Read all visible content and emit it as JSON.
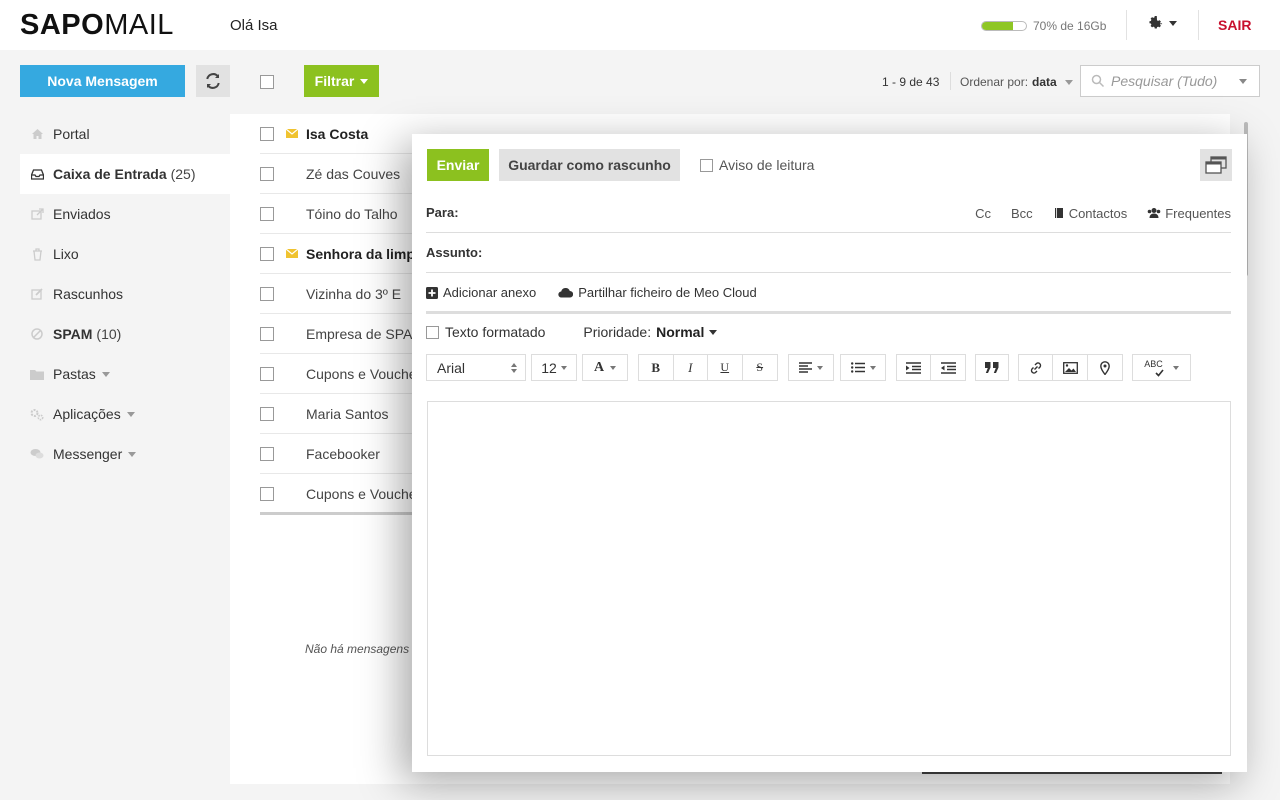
{
  "header": {
    "logo_bold": "SAPO",
    "logo_light": "MAIL",
    "greeting": "Olá Isa",
    "quota_text": "70% de 16Gb",
    "quota_percent": 70,
    "logout": "SAIR",
    "settings_icon": "gear-icon"
  },
  "toolbar": {
    "new_message": "Nova Mensagem",
    "refresh_icon": "refresh-icon",
    "filter": "Filtrar",
    "paging": "1 - 9 de 43",
    "order_label": "Ordenar por:",
    "order_value": "data",
    "search_placeholder": "Pesquisar (Tudo)"
  },
  "sidebar": {
    "items": [
      {
        "label": "Portal",
        "icon": "home-icon",
        "count": ""
      },
      {
        "label": "Caixa de Entrada",
        "icon": "inbox-icon",
        "count": "(25)"
      },
      {
        "label": "Enviados",
        "icon": "sent-icon",
        "count": ""
      },
      {
        "label": "Lixo",
        "icon": "trash-icon",
        "count": ""
      },
      {
        "label": "Rascunhos",
        "icon": "drafts-icon",
        "count": ""
      },
      {
        "label": "SPAM",
        "icon": "spam-icon",
        "count": "(10)"
      },
      {
        "label": "Pastas",
        "icon": "folder-icon",
        "count": ""
      },
      {
        "label": "Aplicações",
        "icon": "apps-icon",
        "count": ""
      },
      {
        "label": "Messenger",
        "icon": "chat-icon",
        "count": ""
      }
    ]
  },
  "messages": [
    {
      "from": "Isa Costa",
      "unread": true
    },
    {
      "from": "Zé das Couves",
      "unread": false
    },
    {
      "from": "Tóino do Talho",
      "unread": false
    },
    {
      "from": "Senhora da limpe",
      "unread": true
    },
    {
      "from": "Vizinha do 3º E",
      "unread": false
    },
    {
      "from": "Empresa de SPAM",
      "unread": false
    },
    {
      "from": "Cupons e Voucher",
      "unread": false
    },
    {
      "from": "Maria Santos",
      "unread": false
    },
    {
      "from": "Facebooker",
      "unread": false
    },
    {
      "from": "Cupons e Voucher",
      "unread": false
    }
  ],
  "no_more": "Não há mensagens s",
  "compose": {
    "send": "Enviar",
    "save_draft": "Guardar como rascunho",
    "read_receipt": "Aviso de leitura",
    "to_label": "Para:",
    "cc": "Cc",
    "bcc": "Bcc",
    "contacts": "Contactos",
    "frequent": "Frequentes",
    "subject_label": "Assunto:",
    "add_attachment": "Adicionar anexo",
    "share_cloud": "Partilhar ficheiro de Meo Cloud",
    "formatted_text": "Texto formatado",
    "priority_label": "Prioridade:",
    "priority_value": "Normal",
    "font_family": "Arial",
    "font_size": "12",
    "font_color_glyph": "A",
    "bold_glyph": "B",
    "italic_glyph": "I",
    "underline_glyph": "U",
    "strike_glyph": "S",
    "spellcheck_glyph": "ABC"
  }
}
